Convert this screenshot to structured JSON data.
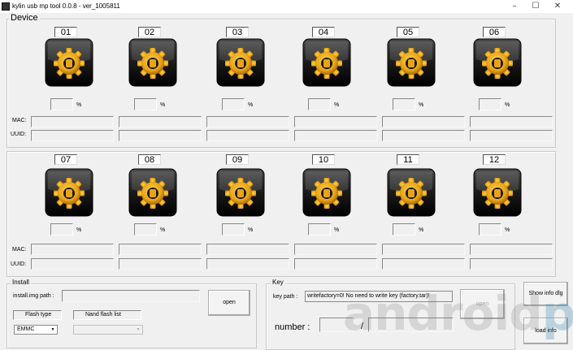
{
  "window": {
    "title": "kylin usb mp tool 0.0.8 - ver_1005811",
    "controls": [
      "minimize",
      "maximize",
      "close"
    ]
  },
  "device_group": {
    "title": "Device",
    "rows": [
      {
        "slots": [
          "01",
          "02",
          "03",
          "04",
          "05",
          "06"
        ],
        "mac_label": "MAC:",
        "uuid_label": "UUID:"
      },
      {
        "slots": [
          "07",
          "08",
          "09",
          "10",
          "11",
          "12"
        ],
        "mac_label": "MAC:",
        "uuid_label": "UUID:"
      }
    ],
    "percent_symbol": "%",
    "icon": "gear-icon",
    "colors": {
      "gear": "#e8a317",
      "icon_bg": "#1a1a1a"
    }
  },
  "install_group": {
    "title": "Install",
    "path_label": "install.img path :",
    "path_value": "",
    "open_label": "open",
    "flash_type_label": "Flash type",
    "flash_type_value": "EMMC",
    "nand_label": "Nand flash list",
    "nand_value": ""
  },
  "key_group": {
    "title": "Key",
    "path_label": "key path :",
    "path_value": "writefactory=0! No need to write key (factory.tar)!",
    "open_label": "open",
    "number_label": "number :",
    "number_value": "",
    "separator": "/",
    "number_total": ""
  },
  "buttons": {
    "show_info": "Show info dlg",
    "load_info": "load info"
  },
  "watermark": {
    "main": "android",
    "accent": "pc"
  }
}
